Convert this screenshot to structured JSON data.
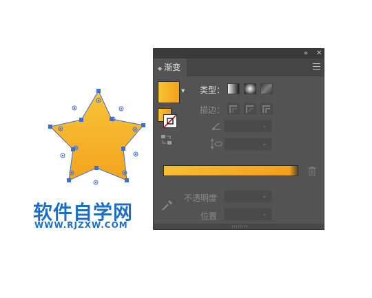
{
  "panel": {
    "tab_label": "渐变",
    "tab_arrows": "◆",
    "collapse_icon": "«",
    "close_icon": "✕",
    "menu_icon": "hamburger-icon",
    "type_label": "类型：",
    "stroke_label": "描边：",
    "opacity_label": "不透明度",
    "position_label": "位置",
    "angle_value": "",
    "aspect_value": "",
    "opacity_value": "",
    "position_value": ""
  },
  "colors": {
    "gradient_start": "#f7c233",
    "gradient_end": "#f3a11a",
    "panel_bg": "#535353",
    "watermark": "#1e6fc4"
  },
  "watermark": {
    "title": "软件自学网",
    "url": "WWW.RJZXW.COM"
  }
}
